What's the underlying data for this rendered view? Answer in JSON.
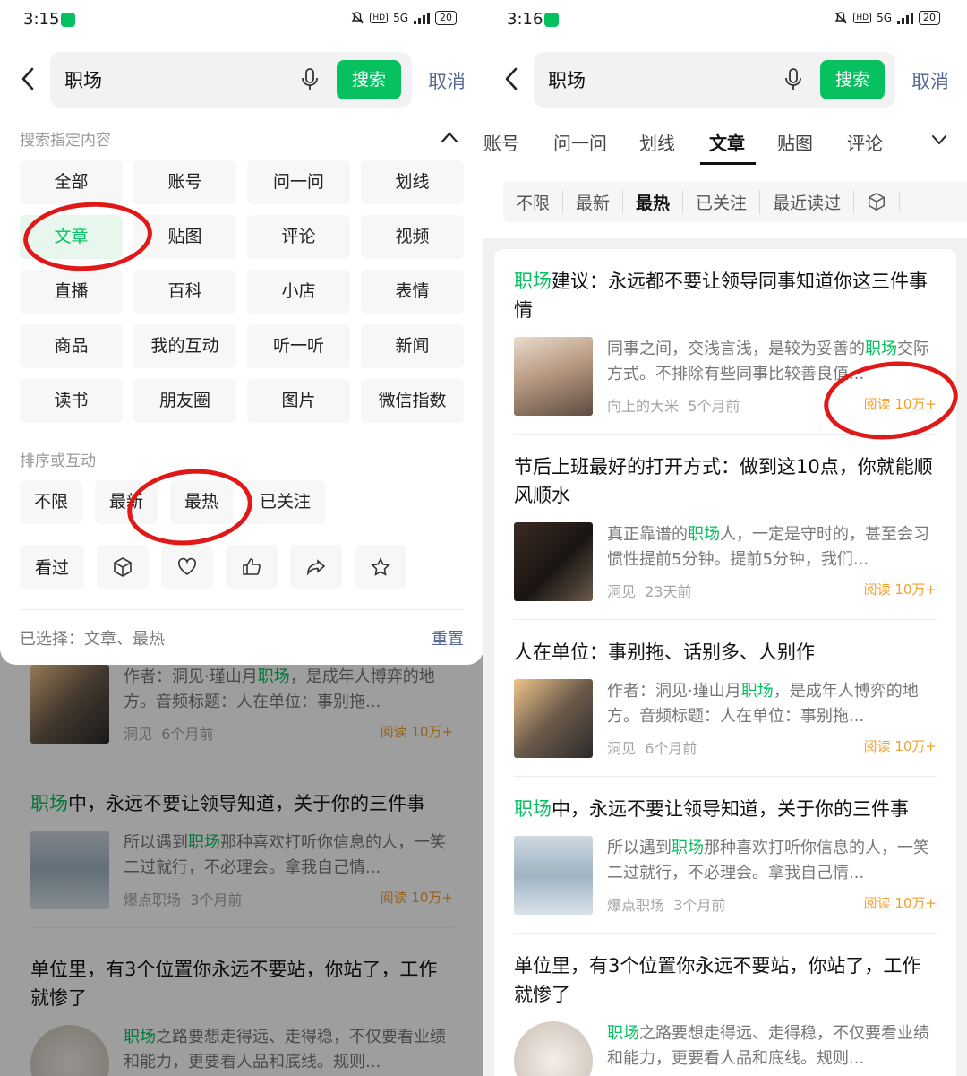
{
  "left": {
    "status": {
      "time": "3:15",
      "hd": "HD",
      "net": "5G",
      "battery": "20"
    },
    "search": {
      "query": "职场",
      "button": "搜索",
      "cancel": "取消"
    },
    "filter": {
      "content_heading": "搜索指定内容",
      "content_types": [
        "全部",
        "账号",
        "问一问",
        "划线",
        "文章",
        "贴图",
        "评论",
        "视频",
        "直播",
        "百科",
        "小店",
        "表情",
        "商品",
        "我的互动",
        "听一听",
        "新闻",
        "读书",
        "朋友圈",
        "图片",
        "微信指数"
      ],
      "active_type": "文章",
      "sort_heading": "排序或互动",
      "sort_options": [
        "不限",
        "最新",
        "最热",
        "已关注"
      ],
      "active_sort": "最热",
      "interaction_label": "看过",
      "interaction_icons": [
        "cube-icon",
        "heart-icon",
        "thumbs-up-icon",
        "share-icon",
        "star-icon"
      ],
      "selected_label": "已选择：文章、最热",
      "reset": "重置"
    },
    "bg_results": [
      {
        "title": "",
        "snippet_pre": "作者：洞见·瑾山月",
        "snippet_hl": "职场",
        "snippet_post": "，是成年人博弈的地方。音频标题：人在单位：事别拖...",
        "source": "洞见",
        "age": "6个月前",
        "reads": "阅读 10万+"
      },
      {
        "title_hl": "职场",
        "title_post": "中，永远不要让领导知道，关于你的三件事",
        "snippet_pre": "所以遇到",
        "snippet_hl": "职场",
        "snippet_post": "那种喜欢打听你信息的人，一笑二过就行，不必理会。拿我自己情...",
        "source": "爆点职场",
        "age": "3个月前",
        "reads": "阅读 10万+"
      },
      {
        "title_post": "单位里，有3个位置你永远不要站，你站了，工作就惨了",
        "snippet_hl": "职场",
        "snippet_post": "之路要想走得远、走得稳，不仅要看业绩和能力，更要看人品和底线。规则..."
      }
    ]
  },
  "right": {
    "status": {
      "time": "3:16",
      "hd": "HD",
      "net": "5G",
      "battery": "20"
    },
    "search": {
      "query": "职场",
      "button": "搜索",
      "cancel": "取消"
    },
    "tabs": [
      "账号",
      "问一问",
      "划线",
      "文章",
      "贴图",
      "评论"
    ],
    "active_tab": "文章",
    "subfilters": [
      "不限",
      "最新",
      "最热",
      "已关注",
      "最近读过"
    ],
    "active_subfilter": "最热",
    "results": [
      {
        "title_hl": "职场",
        "title_post": "建议：永远都不要让领导同事知道你这三件事情",
        "snippet_pre": "同事之间，交浅言浅，是较为妥善的",
        "snippet_hl": "职场",
        "snippet_post": "交际方式。不排除有些同事比较善良值...",
        "source": "向上的大米",
        "age": "5个月前",
        "reads": "阅读 10万+"
      },
      {
        "title_post": "节后上班最好的打开方式：做到这10点，你就能顺风顺水",
        "snippet_pre": "真正靠谱的",
        "snippet_hl": "职场",
        "snippet_post": "人，一定是守时的，甚至会习惯性提前5分钟。提前5分钟，我们...",
        "source": "洞见",
        "age": "23天前",
        "reads": "阅读 10万+"
      },
      {
        "title_post": "人在单位：事别拖、话别多、人别作",
        "snippet_pre": "作者：洞见·瑾山月",
        "snippet_hl": "职场",
        "snippet_post": "，是成年人博弈的地方。音频标题：人在单位：事别拖...",
        "source": "洞见",
        "age": "6个月前",
        "reads": "阅读 10万+"
      },
      {
        "title_hl": "职场",
        "title_post": "中，永远不要让领导知道，关于你的三件事",
        "snippet_pre": "所以遇到",
        "snippet_hl": "职场",
        "snippet_post": "那种喜欢打听你信息的人，一笑二过就行，不必理会。拿我自己情...",
        "source": "爆点职场",
        "age": "3个月前",
        "reads": "阅读 10万+"
      },
      {
        "title_post": "单位里，有3个位置你永远不要站，你站了，工作就惨了",
        "snippet_hl": "职场",
        "snippet_post": "之路要想走得远、走得稳，不仅要看业绩和能力，更要看人品和底线。规则..."
      }
    ]
  },
  "colors": {
    "accent": "#07c160",
    "link": "#576b95",
    "reads": "#f0a030",
    "annotation": "#e11818"
  }
}
